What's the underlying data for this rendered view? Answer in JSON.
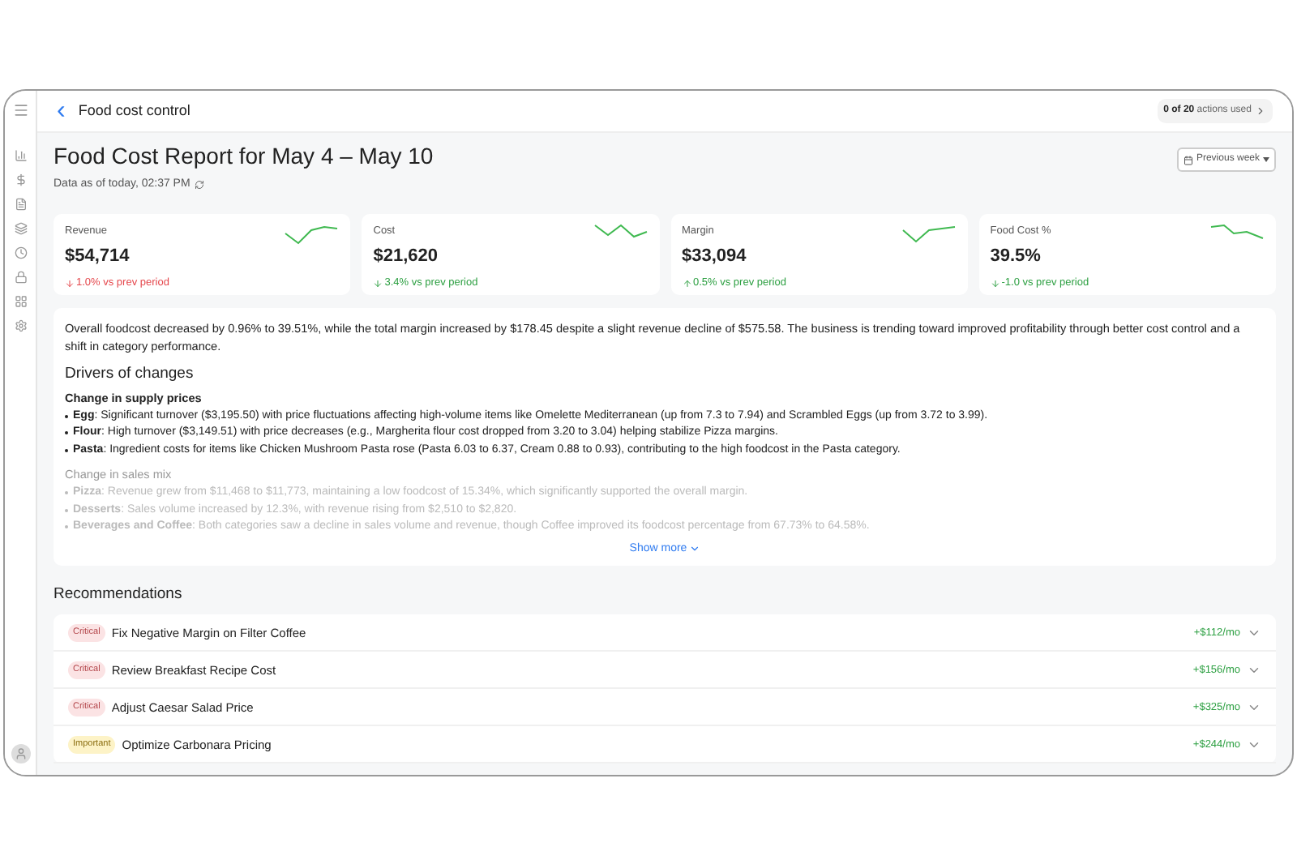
{
  "header": {
    "back": "‹",
    "title": "Food cost control",
    "usage": {
      "count": "0 of 20",
      "label": "actions used"
    }
  },
  "report": {
    "title": "Food Cost Report for May 4 – May 10",
    "as_of": "Data as of today, 02:37 PM",
    "period": "Previous week"
  },
  "metrics": [
    {
      "label": "Revenue",
      "value": "$54,714",
      "change": "1.0% vs prev period",
      "increase": false,
      "favorable": false
    },
    {
      "label": "Cost",
      "value": "$21,620",
      "change": "3.4% vs prev period",
      "increase": false,
      "favorable": true
    },
    {
      "label": "Margin",
      "value": "$33,094",
      "change": "0.5% vs prev period",
      "increase": true,
      "favorable": true
    },
    {
      "label": "Food Cost %",
      "value": "39.5%",
      "change": "-1.0 vs prev period",
      "increase": false,
      "favorable": true
    }
  ],
  "summary": {
    "text": "Overall foodcost decreased by 0.96% to 39.51%, while the total margin increased by $178.45 despite a slight revenue decline of $575.58. The business is trending toward improved profitability through better cost control and a shift in category performance.",
    "heading": "Drivers of changes",
    "sections": [
      {
        "title": "Change in supply prices",
        "faded": false,
        "items": [
          "**Egg**: Significant turnover ($3,195.50) with price fluctuations affecting high-volume items like Omelette Mediterranean (up from 7.3 to 7.94) and Scrambled Eggs (up from 3.72 to 3.99).",
          "**Flour**: High turnover ($3,149.51) with price decreases (e.g., Margherita flour cost dropped from 3.20 to 3.04) helping stabilize Pizza margins.",
          "**Pasta**: Ingredient costs for items like Chicken Mushroom Pasta rose (Pasta 6.03 to 6.37, Cream 0.88 to 0.93), contributing to the high foodcost in the Pasta category."
        ]
      },
      {
        "title": "Change in sales mix",
        "faded": true,
        "items": [
          "**Pizza**: Revenue grew from $11,468 to $11,773, maintaining a low foodcost of 15.34%, which significantly supported the overall margin.",
          "**Desserts**: Sales volume increased by 12.3%, with revenue rising from $2,510 to $2,820.",
          "**Beverages and Coffee**: Both categories saw a decline in sales volume and revenue, though Coffee improved its foodcost percentage from 67.73% to 64.58%."
        ]
      }
    ],
    "show_more": "Show more"
  },
  "recommendations": {
    "title": "Recommendations",
    "items": [
      {
        "kind": "critical",
        "badge": "Critical",
        "title": "Fix Negative Margin on Filter Coffee",
        "impact": "+$112/mo",
        "expanded": false
      },
      {
        "kind": "critical",
        "badge": "Critical",
        "title": "Review Breakfast Recipe Cost",
        "impact": "+$156/mo",
        "expanded": false
      },
      {
        "kind": "critical",
        "badge": "Critical",
        "title": "Adjust Caesar Salad Price",
        "impact": "+$325/mo",
        "expanded": false
      },
      {
        "kind": "important",
        "badge": "Important",
        "title": "Optimize Carbonara Pricing",
        "impact": "+$244/mo",
        "expanded": false
      }
    ]
  }
}
